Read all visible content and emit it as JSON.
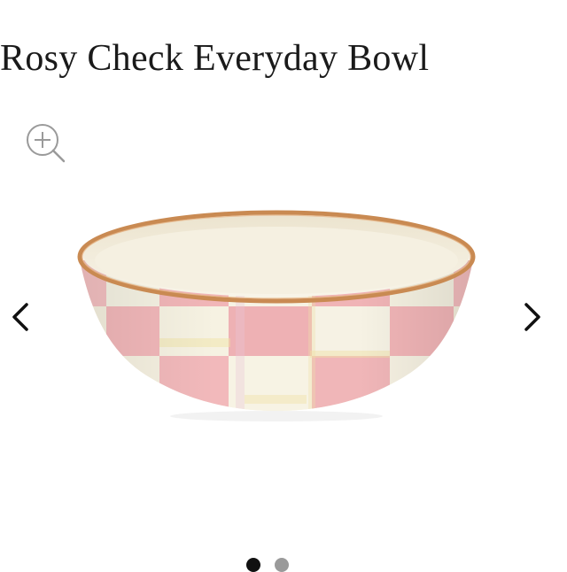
{
  "product": {
    "title": "Rosy Check Everyday Bowl"
  },
  "icons": {
    "zoom": "zoom-in-icon",
    "prev": "chevron-left-icon",
    "next": "chevron-right-icon"
  },
  "colors": {
    "text": "#1a1a1a",
    "gold_rim": "#c98a52",
    "pink_check": "#f1b7b9",
    "cream": "#f6f1e3",
    "dot_active": "#111111",
    "dot_inactive": "#9a9a9a"
  },
  "carousel": {
    "slide_count": 2,
    "active_index": 0
  }
}
